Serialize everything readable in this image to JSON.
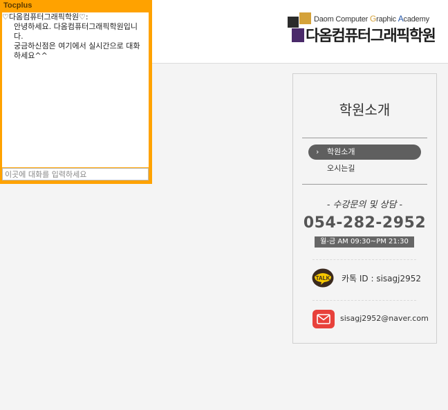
{
  "header": {
    "logo_en_d": "D",
    "logo_en_1": "aom Computer ",
    "logo_en_g": "G",
    "logo_en_2": "raphic ",
    "logo_en_a": "A",
    "logo_en_3": "cademy",
    "logo_ko": "다옴컴퓨터그래픽학원"
  },
  "chat": {
    "title": "Tocplus",
    "sender": "♡다옴컴퓨터그래픽학원♡:",
    "messages": [
      "안녕하세요. 다옴컴퓨터그래픽학원입니다.",
      "궁금하신점은 여기에서 실시간으로 대화하세요^^"
    ],
    "input_placeholder": "이곳에 대화를 입력하세요"
  },
  "sidebar": {
    "title": "학원소개",
    "menu": [
      {
        "label": "학원소개",
        "active": true
      },
      {
        "label": "오시는길",
        "active": false
      }
    ],
    "consult_title": "- 수강문의 및 상담 -",
    "phone": "054-282-2952",
    "hours": "월-금 AM 09:30~PM 21:30",
    "kakao_icon_text": "TALK",
    "kakao_id": "카톡 ID : sisagj2952",
    "email": "sisagj2952@naver.com"
  },
  "colors": {
    "chat_frame": "#ffa200",
    "menu_active_bg": "#5f5f5f",
    "kakao_bubble": "#f7c800",
    "kakao_bg": "#3b2a1e",
    "mail_bg": "#e8413b"
  },
  "icons": {
    "menu_active": "chevron-right-icon",
    "kakao": "kakao-talk-icon",
    "mail": "mail-icon"
  }
}
